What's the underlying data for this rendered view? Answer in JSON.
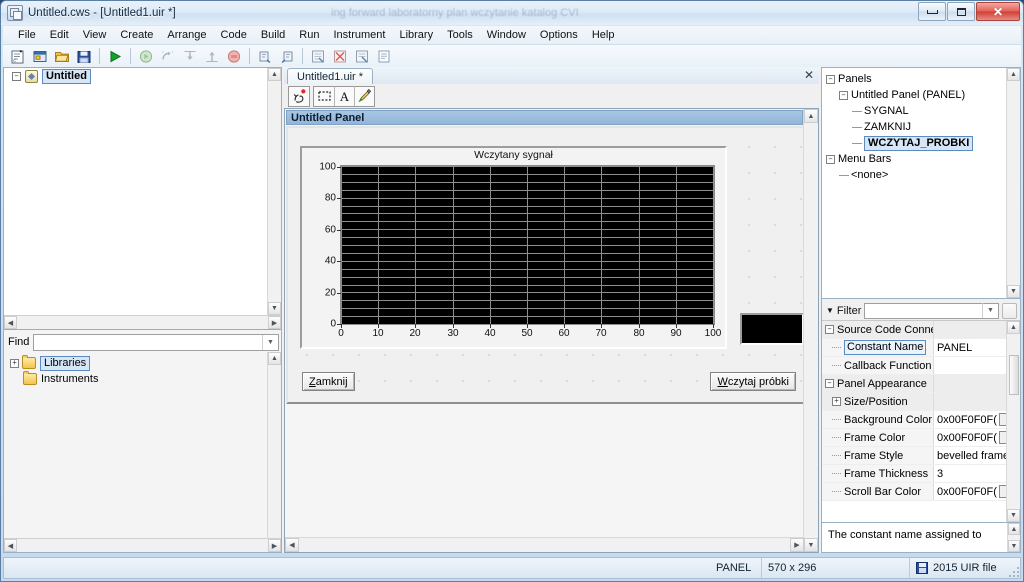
{
  "window": {
    "title": "Untitled.cws - [Untitled1.uir *]",
    "ghost_title": "ing forward laboratorny plan wczytanie katalog CVI",
    "minimize": "–",
    "maximize": "□",
    "close": "✕"
  },
  "menubar": {
    "items": [
      {
        "label": "File",
        "accel": "F"
      },
      {
        "label": "Edit",
        "accel": "E"
      },
      {
        "label": "View",
        "accel": "V"
      },
      {
        "label": "Create",
        "accel": "C"
      },
      {
        "label": "Arrange",
        "accel": "A"
      },
      {
        "label": "Code",
        "accel": "d"
      },
      {
        "label": "Build",
        "accel": "B"
      },
      {
        "label": "Run",
        "accel": "R"
      },
      {
        "label": "Instrument",
        "accel": "I"
      },
      {
        "label": "Library",
        "accel": "L"
      },
      {
        "label": "Tools",
        "accel": "T"
      },
      {
        "label": "Window",
        "accel": "W"
      },
      {
        "label": "Options",
        "accel": "O"
      },
      {
        "label": "Help",
        "accel": "H"
      }
    ]
  },
  "toolbar": {
    "buttons": [
      {
        "name": "new-source-file-icon",
        "tip": "New"
      },
      {
        "name": "new-ui-file-icon",
        "tip": "New UIR"
      },
      {
        "name": "open-file-icon",
        "tip": "Open"
      },
      {
        "name": "save-file-icon",
        "tip": "Save"
      },
      {
        "name": "run-project-icon",
        "tip": "Run Project"
      },
      {
        "name": "continue-debug-icon",
        "tip": "Continue"
      },
      {
        "name": "step-over-icon",
        "tip": "Step Over"
      },
      {
        "name": "step-into-icon",
        "tip": "Step Into"
      },
      {
        "name": "step-out-icon",
        "tip": "Step Out"
      },
      {
        "name": "terminate-execution-icon",
        "tip": "Terminate"
      },
      {
        "name": "find-previous-icon",
        "tip": "Find Previous"
      },
      {
        "name": "find-next-icon",
        "tip": "Find Next"
      },
      {
        "name": "view-variables-icon",
        "tip": "Variables"
      },
      {
        "name": "clear-errors-icon",
        "tip": "Clear"
      },
      {
        "name": "build-errors-icon",
        "tip": "Build Errors"
      },
      {
        "name": "view-output-icon",
        "tip": "Output"
      }
    ]
  },
  "workspace": {
    "root_label": "Untitled",
    "expander": "–"
  },
  "find": {
    "label": "Find",
    "placeholder": "",
    "value": "",
    "tree": [
      {
        "label": "Libraries",
        "expander": "+",
        "selected": true
      },
      {
        "label": "Instruments",
        "expander": "",
        "selected": false
      }
    ]
  },
  "editor": {
    "tab_label": "Untitled1.uir *",
    "close_label": "✕",
    "tools": [
      {
        "name": "operate-tool-icon"
      },
      {
        "name": "select-tool-icon"
      },
      {
        "name": "label-tool-icon"
      },
      {
        "name": "color-tool-icon"
      }
    ],
    "panel_title": "Untitled Panel"
  },
  "design_panel": {
    "graph_title": "Wczytany sygnał",
    "buttons": [
      {
        "label": "Zamknij",
        "accel": "Z",
        "name": "zamknij-button"
      },
      {
        "label": "Wczytaj próbki",
        "accel": "W",
        "name": "wczytaj-probki-button"
      }
    ],
    "legend_name": "graph-legend-box"
  },
  "chart_data": {
    "type": "line",
    "title": "Wczytany sygnał",
    "xlabel": "",
    "ylabel": "",
    "series": [],
    "x_ticks": [
      0,
      10,
      20,
      30,
      40,
      50,
      60,
      70,
      80,
      90,
      100
    ],
    "y_ticks": [
      0,
      20,
      40,
      60,
      80,
      100
    ],
    "xlim": [
      0,
      100
    ],
    "ylim": [
      0,
      100
    ],
    "grid": true,
    "grid_color": "#8f8f8f",
    "plot_bg": "#000000",
    "minor_y_divisions": 20,
    "legend": "position-bottom-right-external"
  },
  "panels_tree": {
    "nodes": [
      {
        "label": "Panels",
        "depth": 0,
        "expander": "–",
        "selected": false
      },
      {
        "label": "Untitled Panel (PANEL)",
        "depth": 1,
        "expander": "–",
        "selected": false
      },
      {
        "label": "SYGNAL",
        "depth": 2,
        "expander": "",
        "selected": false
      },
      {
        "label": "ZAMKNIJ",
        "depth": 2,
        "expander": "",
        "selected": false
      },
      {
        "label": "WCZYTAJ_PROBKI",
        "depth": 2,
        "expander": "",
        "selected": true
      },
      {
        "label": "Menu Bars",
        "depth": 0,
        "expander": "–",
        "selected": false
      },
      {
        "label": "<none>",
        "depth": 1,
        "expander": "",
        "selected": false
      }
    ]
  },
  "properties": {
    "filter_label": "Filter",
    "filter_value": "",
    "rows": [
      {
        "name": "Source Code Connecti",
        "value": "",
        "kind": "category",
        "expander": "–"
      },
      {
        "name": "Constant Name",
        "value": "PANEL",
        "kind": "prop",
        "selected": true
      },
      {
        "name": "Callback Function",
        "value": "",
        "kind": "prop"
      },
      {
        "name": "Panel Appearance",
        "value": "",
        "kind": "category",
        "expander": "–"
      },
      {
        "name": "Size/Position",
        "value": "",
        "kind": "subcategory",
        "expander": "+"
      },
      {
        "name": "Background Color",
        "value": "0x00F0F0F(",
        "kind": "prop",
        "swatch": "#f0f0f0"
      },
      {
        "name": "Frame Color",
        "value": "0x00F0F0F(",
        "kind": "prop",
        "swatch": "#f0f0f0"
      },
      {
        "name": "Frame Style",
        "value": "bevelled frame",
        "kind": "prop"
      },
      {
        "name": "Frame Thickness",
        "value": "3",
        "kind": "prop"
      },
      {
        "name": "Scroll Bar Color",
        "value": "0x00F0F0F(",
        "kind": "prop",
        "swatch": "#f0f0f0"
      }
    ],
    "help_text": "The constant name assigned to"
  },
  "statusbar": {
    "target": "PANEL",
    "size": "570 x 296",
    "file_type": "2015 UIR file"
  }
}
